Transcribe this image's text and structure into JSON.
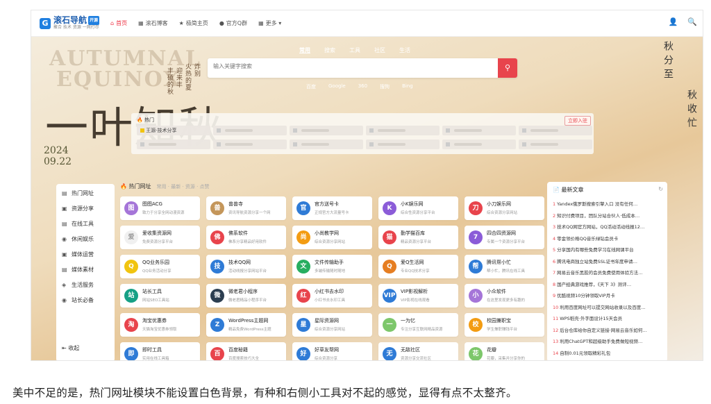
{
  "header": {
    "logo": {
      "name": "滚石导航",
      "badge": "开源",
      "slogan": "聚合 技术 资源 一网打尽"
    },
    "nav": [
      {
        "icon": "home-icon",
        "glyph": "⌂",
        "label": "首页",
        "active": true
      },
      {
        "icon": "grid-icon",
        "glyph": "▦",
        "label": "滚石博客",
        "active": false
      },
      {
        "icon": "star-icon",
        "glyph": "★",
        "label": "极简主页",
        "active": false
      },
      {
        "icon": "qq-icon",
        "glyph": "●",
        "label": "官方Q群",
        "active": false
      },
      {
        "icon": "more-icon",
        "glyph": "▦",
        "label": "更多 ▾",
        "active": false
      }
    ],
    "user_glyph": "👤",
    "search_glyph": "🔍"
  },
  "hero": {
    "deco_en1": "AUTUMNAL",
    "deco_en2": "EQUINOX",
    "deco_cn": "一叶知秋",
    "year": "2024",
    "date": "09.22",
    "vert_lines": [
      "炸别",
      "火热的夏",
      "迎来丰",
      "丰硕的秋"
    ],
    "right_vert": [
      "秋分至",
      "秋收忙"
    ]
  },
  "search": {
    "tabs": [
      "常用",
      "搜索",
      "工具",
      "社区",
      "生活"
    ],
    "active_tab": "常用",
    "placeholder": "输入关键字搜索",
    "button_glyph": "⚲",
    "engines": [
      "百度",
      "Google",
      "360",
      "搜狗",
      "Bing"
    ]
  },
  "hot": {
    "title": "热门",
    "submit": "立即入驻",
    "first_item": "王源·技术分享"
  },
  "sidebar": {
    "items": [
      {
        "glyph": "▤",
        "label": "热门网址"
      },
      {
        "glyph": "▣",
        "label": "资源分享"
      },
      {
        "glyph": "▤",
        "label": "在线工具"
      },
      {
        "glyph": "◉",
        "label": "休闲娱乐"
      },
      {
        "glyph": "▣",
        "label": "媒体运营"
      },
      {
        "glyph": "▤",
        "label": "媒体素材"
      },
      {
        "glyph": "◈",
        "label": "生活服务"
      },
      {
        "glyph": "◉",
        "label": "站长必备"
      }
    ],
    "collapse": "收起"
  },
  "main": {
    "title": "热门网址",
    "subtitle": "常用 · 最新 · 资源 · 点赞",
    "cards": [
      {
        "name": "图图ACG",
        "desc": "致力于分享全网动漫资源",
        "color": "#a575d8",
        "glyph": "图"
      },
      {
        "name": "兽兽寺",
        "desc": "资讯导航资源分享一个网",
        "color": "#c4965a",
        "glyph": "兽"
      },
      {
        "name": "官方送号卡",
        "desc": "正规官方大流量号卡",
        "color": "#2f7bd6",
        "glyph": "官"
      },
      {
        "name": "小K娱乐网",
        "desc": "综合性资源分享平台",
        "color": "#8b5cd8",
        "glyph": "K"
      },
      {
        "name": "小刀娱乐网",
        "desc": "综合资源分享网站",
        "color": "#e8444c",
        "glyph": "刀"
      },
      {
        "name": "爱收集资源网",
        "desc": "免费资源分享平台",
        "color": "#f0f0f0",
        "glyph": "爱"
      },
      {
        "name": "佛系软件",
        "desc": "佛系分享精品好用软件",
        "color": "#e8444c",
        "glyph": "佛"
      },
      {
        "name": "小尚教学网",
        "desc": "综合资源分享网站",
        "color": "#f39c12",
        "glyph": "尚"
      },
      {
        "name": "勤学猫百库",
        "desc": "精品资源分享平台",
        "color": "#e8444c",
        "glyph": "猫"
      },
      {
        "name": "四合四资源网",
        "desc": "专属一个资源分享平台",
        "color": "#8b5cd8",
        "glyph": "7"
      },
      {
        "name": "QQ业务乐园",
        "desc": "QQ业务活动分享",
        "color": "#f1c40f",
        "glyph": "Q"
      },
      {
        "name": "技术QQ网",
        "desc": "活动线报分享网站平台",
        "color": "#2f7bd6",
        "glyph": "技"
      },
      {
        "name": "文件传输助手",
        "desc": "多端传输随时随地",
        "color": "#27ae60",
        "glyph": "文"
      },
      {
        "name": "爱Q生活网",
        "desc": "专业QQ技术分享",
        "color": "#e67e22",
        "glyph": "Q"
      },
      {
        "name": "腾讯帮小忙",
        "desc": "帮小忙，腾讯在线工具",
        "color": "#2f7bd6",
        "glyph": "帮"
      },
      {
        "name": "站长工具",
        "desc": "网站SEO工具站",
        "color": "#16a085",
        "glyph": "站"
      },
      {
        "name": "微老君小程序",
        "desc": "微老君精品小程序平台",
        "color": "#2c3e50",
        "glyph": "微"
      },
      {
        "name": "小红书去水印",
        "desc": "小红书去水印工具",
        "color": "#e8444c",
        "glyph": "红"
      },
      {
        "name": "VIP影视解析",
        "desc": "VIP影视在线观看",
        "color": "#2f7bd6",
        "glyph": "VIP"
      },
      {
        "name": "小众软件",
        "desc": "在这里发现更多有趣的",
        "color": "#a575d8",
        "glyph": "小"
      },
      {
        "name": "淘宝优惠券",
        "desc": "天猫淘宝优惠券领取",
        "color": "#e8444c",
        "glyph": "淘"
      },
      {
        "name": "WordPress主题网",
        "desc": "精品免费WordPress主题",
        "color": "#2f7bd6",
        "glyph": "Z"
      },
      {
        "name": "星际资源网",
        "desc": "综合资源分享网站",
        "color": "#2f7bd6",
        "glyph": "星"
      },
      {
        "name": "一为忆",
        "desc": "专注分享互联网精品资源",
        "color": "#7dc76b",
        "glyph": "一"
      },
      {
        "name": "校园兼职宝",
        "desc": "学生兼职赚钱平台",
        "color": "#f39c12",
        "glyph": "校"
      },
      {
        "name": "即时工具",
        "desc": "实用在线工具箱",
        "color": "#2f7bd6",
        "glyph": "即"
      },
      {
        "name": "百度秘籍",
        "desc": "百度搜索技巧大全",
        "color": "#e8444c",
        "glyph": "百"
      },
      {
        "name": "好草友帮网",
        "desc": "综合资源分享",
        "color": "#2f7bd6",
        "glyph": "好"
      },
      {
        "name": "无敌社区",
        "desc": "资源分享交流社区",
        "color": "#2f7bd6",
        "glyph": "无"
      },
      {
        "name": "花瓣",
        "desc": "花瓣，采集并分享你的",
        "color": "#7dc76b",
        "glyph": "花"
      }
    ]
  },
  "articles": {
    "title": "最新文章",
    "refresh_glyph": "↻",
    "items": [
      "Yandex俄罗斯搜索引擎入口 没有任何…",
      "知识付费项目，团队分站合伙人·低成本…",
      "技术QQ网官方网站，QQ活动活动线报12…",
      "零金领价格QQ音乐绿钻会员卡",
      "分享国内有哪些免费学习在线网课平台",
      "腾讯电商独立站免费SSL证书年度申请…",
      "网易云音乐黑胶的会员免费使用体验方法…",
      "国产经典游戏推荐，《天下 3》测评…",
      "优酷视频10分钟领取VIP月卡",
      "利用百度网址可以提交网站收录以及百度…",
      "WPS稻壳·外字面设计15天会员",
      "后台仓库给你自定义链接·网易云音乐如何…",
      "利用ChatGPT和超级助手免费做短视频…",
      "自制0.01元领取精彩礼包"
    ]
  },
  "caption": "美中不足的是，热门网址模块不能设置白色背景，有种和右侧小工具对不起的感觉，显得有点不太整齐。"
}
